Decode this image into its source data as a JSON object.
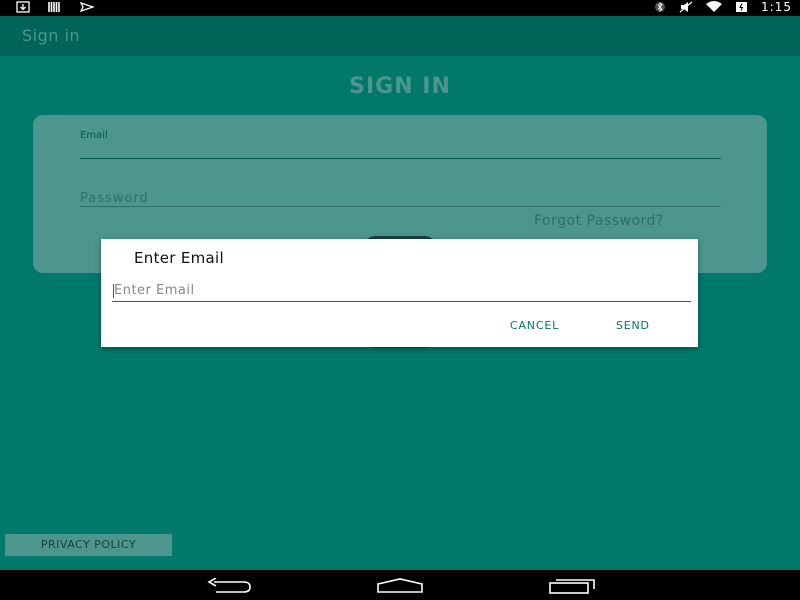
{
  "status_bar": {
    "time": "1:15",
    "left_icons": [
      "download-icon",
      "barcode-icon",
      "send-icon"
    ],
    "right_icons": [
      "bluetooth-icon",
      "mute-icon",
      "wifi-icon",
      "battery-icon"
    ]
  },
  "app_bar": {
    "title": "Sign in"
  },
  "main": {
    "heading": "SIGN IN",
    "email_label": "Email",
    "password_hint": "Password",
    "forgot_password": "Forgot Password?"
  },
  "footer": {
    "privacy_policy": "PRIVACY POLICY"
  },
  "dialog": {
    "title": "Enter Email",
    "input_value": "",
    "input_placeholder": "Enter Email",
    "cancel": "CANCEL",
    "send": "SEND"
  },
  "nav_bar": {
    "icons": [
      "back-icon",
      "home-icon",
      "recents-icon"
    ]
  },
  "colors": {
    "accent": "#00796b",
    "status_bar": "#000000",
    "dialog_bg": "#ffffff"
  }
}
